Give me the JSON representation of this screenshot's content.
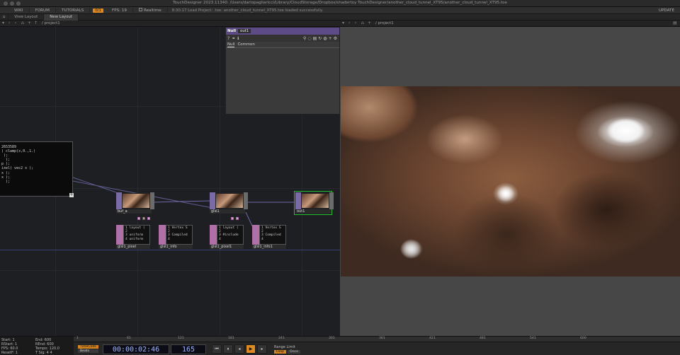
{
  "window": {
    "title": "TouchDesigner 2023.11340: /Users/dariopagliaricci/Library/CloudStorage/Dropbox/shadertoy TouchDesigner/another_cloud_tunnel_XT95/another_cloud_tunnel_XT95.toe"
  },
  "menubar": {
    "wiki": "WIKI",
    "forum": "FORUM",
    "tutorials": "TUTORIALS",
    "badge": "0/1",
    "fps_label": "FPS:",
    "fps_value": "19",
    "realtime": "Realtime",
    "log": "8:30:17 Load Project: .toe: another_cloud_tunnel_XT95.toe loaded successfully.",
    "update": "UPDATE"
  },
  "layouts": {
    "view_layout": "View Layout",
    "new_layout": "New Layout"
  },
  "left_pane": {
    "path": "/ project1"
  },
  "right_pane": {
    "path": "/ project1"
  },
  "textdat": {
    "lines": "2653589\n) clamp(x,0.,1.)\n );\n  );\np );\nixel( vec2 x );\nx );\nx );\n  );"
  },
  "params": {
    "type": "Null",
    "name": "out1",
    "tabs": [
      "Null",
      "Common"
    ]
  },
  "nodes": {
    "buf_a": "buf_a",
    "glsl1": "glsl1",
    "out1": "out1"
  },
  "dats": {
    "glsl1_pixel": {
      "label": "glsl1_pixel",
      "text": "1 layout (\n2\n3 uniform\n4 uniform"
    },
    "glsl1_info": {
      "label": "glsl1_info",
      "text": "1 Vertex S\n2\n3 Compiled\n4"
    },
    "glsl1_pixel1": {
      "label": "glsl1_pixel1",
      "text": "1 layout (\n2\n3 #include\n4"
    },
    "glsl1_info1": {
      "label": "glsl1_info1",
      "text": "1 Vertex S\n2\n3 Compiled\n4"
    }
  },
  "timeline": {
    "start_label": "Start:",
    "start": "1",
    "end_label": "End:",
    "end": "600",
    "rstart_label": "RStart:",
    "rstart": "1",
    "rend_label": "REnd:",
    "rend": "600",
    "fps_label": "FPS:",
    "fps": "60.0",
    "tempo_label": "Tempo:",
    "tempo": "120.0",
    "reset_label": "ResetF:",
    "reset": "1",
    "tsig_label": "T Sig:",
    "tsig_a": "4",
    "tsig_b": "4",
    "timecode_btn": "TimeCode",
    "beats_btn": "Beats",
    "timecode": "00:00:02:46",
    "frame": "165",
    "range_limit": "Range Limit",
    "loop": "Loop",
    "once": "Once",
    "ticks": [
      "1",
      "61",
      "121",
      "181",
      "241",
      "301",
      "361",
      "421",
      "481",
      "541",
      "600"
    ]
  },
  "colors": {
    "accent": "#e0891c",
    "selected": "#22c12e",
    "top_color": "#7a6aa8",
    "dat_color": "#b16fa7"
  }
}
